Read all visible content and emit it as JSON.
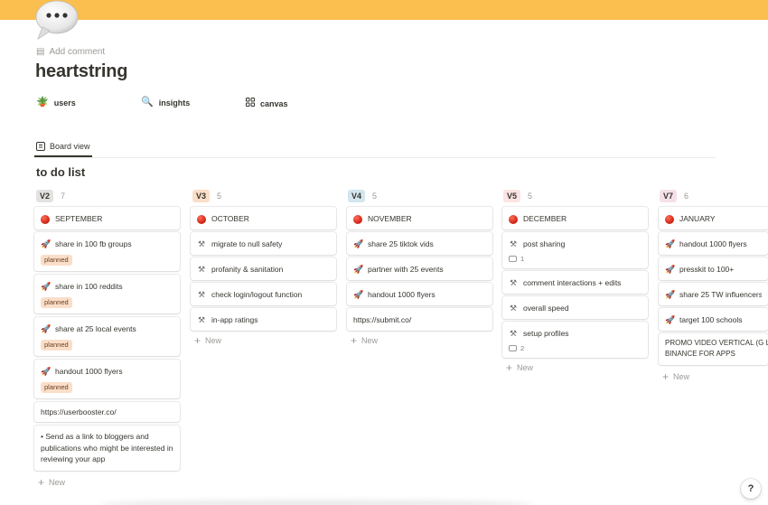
{
  "page": {
    "title": "heartstring",
    "add_comment": "Add comment",
    "accent_color": "#fbbf4f",
    "page_icon": "speech-bubble-icon"
  },
  "links": [
    {
      "label": "users",
      "icon": "plant-icon"
    },
    {
      "label": "insights",
      "icon": "magnifier-icon"
    },
    {
      "label": "canvas",
      "icon": "grid-icon"
    }
  ],
  "view": {
    "tab_label": "Board view"
  },
  "database": {
    "title": "to do list",
    "new_label": "New"
  },
  "columns": [
    {
      "tag": "V2",
      "count": "7",
      "tag_color": "#e3e2e0",
      "group": "SEPTEMBER",
      "cards": [
        {
          "text": "share in 100 fb groups",
          "icon": "rocket-icon",
          "badge": "planned"
        },
        {
          "text": "share in 100 reddits",
          "icon": "rocket-icon",
          "badge": "planned"
        },
        {
          "text": "share at 25 local events",
          "icon": "rocket-icon",
          "badge": "planned"
        },
        {
          "text": "handout 1000 flyers",
          "icon": "rocket-icon",
          "badge": "planned"
        },
        {
          "text": "https://userbooster.co/"
        },
        {
          "text": "• Send as a link to bloggers and publications who might be interested in reviewing your app"
        }
      ]
    },
    {
      "tag": "V3",
      "count": "5",
      "tag_color": "#fadec9",
      "group": "OCTOBER",
      "cards": [
        {
          "text": "migrate to null safety",
          "icon": "tools-icon"
        },
        {
          "text": "profanity & sanitation",
          "icon": "tools-icon"
        },
        {
          "text": "check login/logout function",
          "icon": "tools-icon"
        },
        {
          "text": "in-app ratings",
          "icon": "tools-icon"
        }
      ]
    },
    {
      "tag": "V4",
      "count": "5",
      "tag_color": "#d3e5ef",
      "group": "NOVEMBER",
      "cards": [
        {
          "text": "share 25 tiktok vids",
          "icon": "rocket-icon"
        },
        {
          "text": "partner with 25 events",
          "icon": "rocket-icon"
        },
        {
          "text": "handout 1000 flyers",
          "icon": "rocket-icon"
        },
        {
          "text": "https://submit.co/"
        }
      ]
    },
    {
      "tag": "V5",
      "count": "5",
      "tag_color": "#fbe4e4",
      "group": "DECEMBER",
      "cards": [
        {
          "text": "post sharing",
          "icon": "tools-icon",
          "comments": "1"
        },
        {
          "text": "comment interactions + edits",
          "icon": "tools-icon"
        },
        {
          "text": "overall speed",
          "icon": "tools-icon"
        },
        {
          "text": "setup profiles",
          "icon": "tools-icon",
          "comments": "2"
        }
      ]
    },
    {
      "tag": "V7",
      "count": "6",
      "tag_color": "#f5e0e9",
      "group": "JANUARY",
      "cards": [
        {
          "text": "handout 1000 flyers",
          "icon": "rocket-icon"
        },
        {
          "text": "presskit to 100+",
          "icon": "rocket-icon"
        },
        {
          "text": "share 25 TW influencers",
          "icon": "rocket-icon"
        },
        {
          "text": "target 100 schools",
          "icon": "rocket-icon"
        },
        {
          "text": "PROMO VIDEO VERTICAL (G LIKE ON BINANCE FOR APPS"
        }
      ]
    }
  ],
  "help": {
    "label": "?"
  }
}
